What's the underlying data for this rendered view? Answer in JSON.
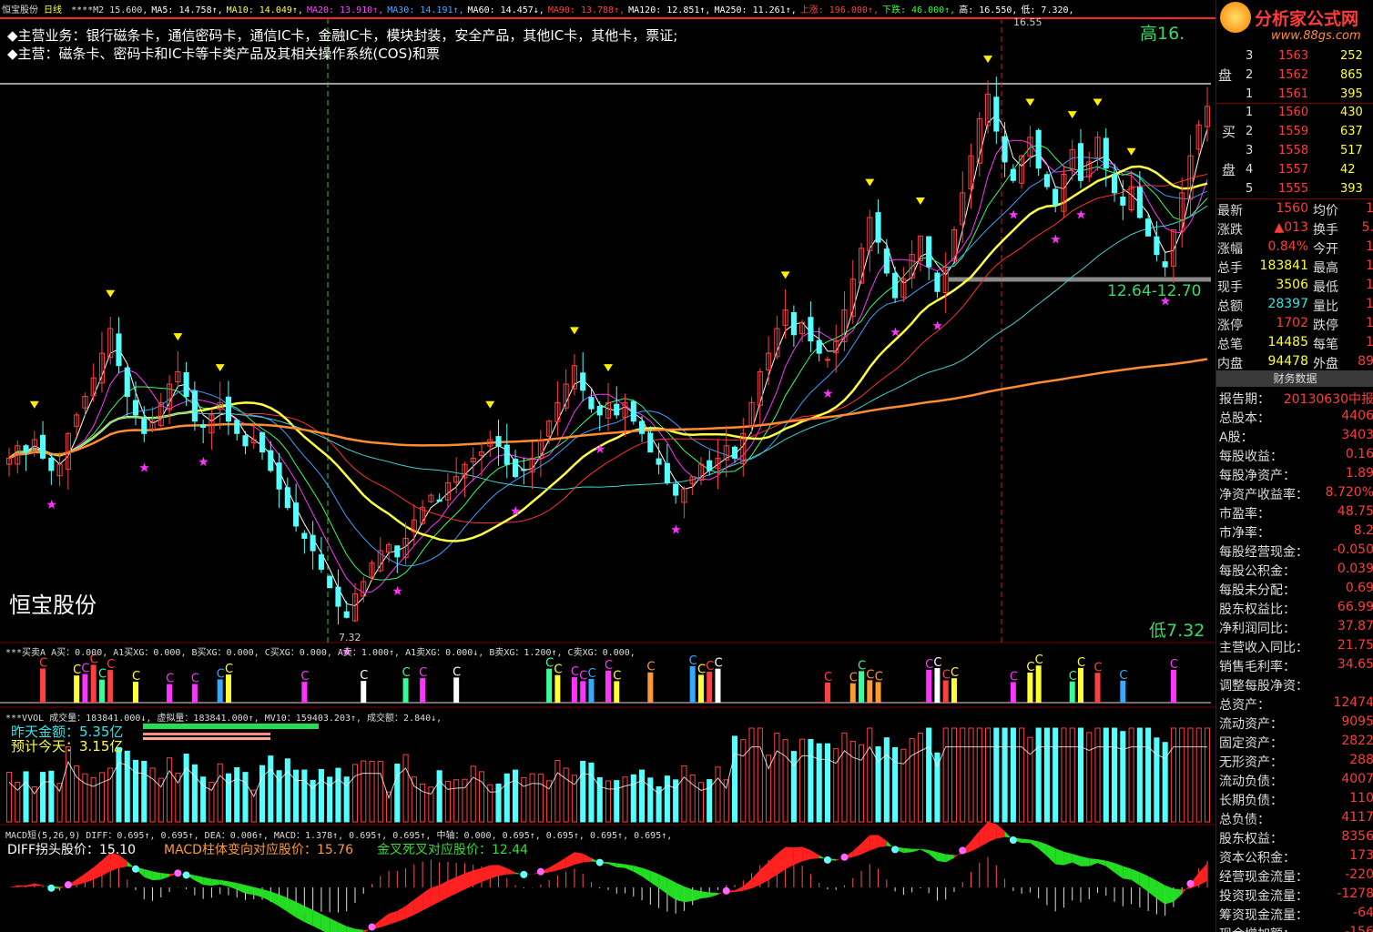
{
  "colors": {
    "up": "#ff4040",
    "down": "#54ffff",
    "ma5": "#ffffff",
    "ma10": "#ffff00",
    "ma20": "#ff33ff",
    "ma30": "#3aa0ff",
    "ma60": "#ffff44",
    "ma120": "#40d0d0",
    "ma250": "#ff8c30",
    "grid": "#7a0000"
  },
  "header": {
    "name": "恒宝股份",
    "period": "日线",
    "ma_items": [
      {
        "t": "****M2 15.600,",
        "c": "#dddddd"
      },
      {
        "t": "MA5: 14.758↑,",
        "c": "#ffffff"
      },
      {
        "t": "MA10: 14.049↑,",
        "c": "#ffff44"
      },
      {
        "t": "MA20: 13.910↑,",
        "c": "#ff44ff"
      },
      {
        "t": "MA30: 14.191↑,",
        "c": "#44aaff"
      },
      {
        "t": "MA60: 14.457↓,",
        "c": "#ffffff"
      },
      {
        "t": "MA90: 13.788↑,",
        "c": "#ff4040"
      },
      {
        "t": "MA120: 12.851↑,",
        "c": "#ffffff"
      },
      {
        "t": "MA250: 11.261↑,",
        "c": "#ffffff"
      },
      {
        "t": "上涨: 196.000↑,",
        "c": "#ff4040"
      },
      {
        "t": "下跌: 46.000↑,",
        "c": "#33ff33"
      },
      {
        "t": "高: 16.550,",
        "c": "#ffffff"
      },
      {
        "t": "低: 7.320,",
        "c": "#ffffff"
      }
    ],
    "business_line1": "◆主营业务：银行磁条卡，通信密码卡，通信IC卡，金融IC卡，模块封装，安全产品，其他IC卡，其他卡，票证;",
    "business_line2": "◆主营：磁条卡、密码卡和IC卡等卡类产品及其相关操作系统(COS)和票"
  },
  "chart_data": {
    "type": "candlestick",
    "stock_name": "恒宝股份",
    "high_label": "高16.",
    "high_mark": "16.55",
    "low_label": "低7.32",
    "low_mark": "7.32",
    "support_label": "12.64-12.70",
    "ylim": [
      7.0,
      17.0
    ],
    "close": [
      9.9,
      10.1,
      10.0,
      10.2,
      9.9,
      9.7,
      9.8,
      10.3,
      10.6,
      10.9,
      11.2,
      11.6,
      12.0,
      11.4,
      10.9,
      10.6,
      10.3,
      10.5,
      10.8,
      11.1,
      11.3,
      10.9,
      10.5,
      10.4,
      10.6,
      10.8,
      10.5,
      10.3,
      10.1,
      10.2,
      10.0,
      9.7,
      9.4,
      9.1,
      8.8,
      8.6,
      8.4,
      8.1,
      7.8,
      7.5,
      7.32,
      7.7,
      7.9,
      8.2,
      8.4,
      8.5,
      8.3,
      8.6,
      8.9,
      9.1,
      9.3,
      9.2,
      9.5,
      9.6,
      9.8,
      9.9,
      10.0,
      10.2,
      10.1,
      9.8,
      9.6,
      9.7,
      9.9,
      10.2,
      10.5,
      10.8,
      11.1,
      11.4,
      11.0,
      10.7,
      10.6,
      10.8,
      10.6,
      10.8,
      10.5,
      10.3,
      10.0,
      9.8,
      9.5,
      9.3,
      9.4,
      9.6,
      9.8,
      9.7,
      9.9,
      10.1,
      9.9,
      10.3,
      10.8,
      11.3,
      11.6,
      12.0,
      12.3,
      11.9,
      12.1,
      11.8,
      11.6,
      11.5,
      11.8,
      12.3,
      12.8,
      13.3,
      13.8,
      13.4,
      12.9,
      12.5,
      12.8,
      13.2,
      13.5,
      13.0,
      12.6,
      13.0,
      13.6,
      14.2,
      14.8,
      15.4,
      15.8,
      15.2,
      14.7,
      14.4,
      14.8,
      15.1,
      14.6,
      14.3,
      14.0,
      14.5,
      14.9,
      14.4,
      14.7,
      15.1,
      14.6,
      14.2,
      14.0,
      14.3,
      13.8,
      13.5,
      13.2,
      13.0,
      13.6,
      14.2,
      14.8,
      15.3,
      15.6
    ],
    "vol_labels": {
      "title": "***VVOL 成交量：183841.000↓, 虚拟量：183841.000↑, MV10：159403.203↑, 成交额：2.840↓,",
      "yesterday": "昨天金额：5.35亿",
      "today": "预计今天：3.15亿"
    },
    "buysell_title": "***买卖A A买：0.000, A1买XG：0.000, B买XG：0.000, C买XG：0.000, A卖：1.000↑, A1卖XG：0.000↓, B卖XG：1.200↑, C卖XG：0.000,",
    "macd_labels": {
      "title": "MACD短(5,26,9) DIFF：0.695↑, 0.695↑, DEA：0.006↑, MACD：1.378↑, 0.695↑, 0.695↑, 中轴：0.000, 0.695↑, 0.695↑, 0.695↑, 0.695↑,",
      "diff_price": "DIFF拐头股价：15.10",
      "macd_price": "MACD柱体变向对应股价：15.76",
      "cross_price": "金叉死叉对应股价：12.44"
    }
  },
  "orderbook": {
    "sell": [
      {
        "lvl": "3",
        "price": "1563",
        "vol": "252"
      },
      {
        "lvl": "2",
        "price": "1562",
        "vol": "865"
      },
      {
        "lvl": "1",
        "price": "1561",
        "vol": "395"
      }
    ],
    "buy": [
      {
        "lvl": "1",
        "price": "1560",
        "vol": "430"
      },
      {
        "lvl": "2",
        "price": "1559",
        "vol": "637"
      },
      {
        "lvl": "3",
        "price": "1558",
        "vol": "517"
      },
      {
        "lvl": "4",
        "price": "1557",
        "vol": "42"
      },
      {
        "lvl": "5",
        "price": "1555",
        "vol": "393"
      }
    ],
    "sell_label_1": "盘",
    "buy_label_1": "买",
    "buy_label_2": "盘"
  },
  "quote": [
    {
      "k": "最新",
      "v": "1560",
      "k2": "均价",
      "v2": "1"
    },
    {
      "k": "涨跌",
      "v": "▲013",
      "k2": "换手",
      "v2": "5."
    },
    {
      "k": "涨幅",
      "v": "0.84%",
      "k2": "今开",
      "v2": "1"
    },
    {
      "k": "总手",
      "v": "183841",
      "k2": "最高",
      "v2": "1"
    },
    {
      "k": "现手",
      "v": "3506",
      "k2": "最低",
      "v2": "1"
    },
    {
      "k": "总额",
      "v": "28397",
      "k2": "量比",
      "v2": "1"
    },
    {
      "k": "涨停",
      "v": "1702",
      "k2": "跌停",
      "v2": "1"
    },
    {
      "k": "总笔",
      "v": "14485",
      "k2": "每笔",
      "v2": "1"
    },
    {
      "k": "内盘",
      "v": "94478",
      "k2": "外盘",
      "v2": "89"
    }
  ],
  "fin_title": "财务数据",
  "fin": [
    {
      "k": "报告期：",
      "v": "20130630中报"
    },
    {
      "k": "总股本：",
      "v": "4406"
    },
    {
      "k": "A股：",
      "v": "3403"
    },
    {
      "k": "每股收益：",
      "v": "0.16"
    },
    {
      "k": "每股净资产：",
      "v": "1.89"
    },
    {
      "k": "净资产收益率：",
      "v": "8.720%"
    },
    {
      "k": "市盈率：",
      "v": "48.75"
    },
    {
      "k": "市净率：",
      "v": "8.2"
    },
    {
      "k": "每股经营现金：",
      "v": "-0.050"
    },
    {
      "k": "每股公积金：",
      "v": "0.039"
    },
    {
      "k": "每股未分配：",
      "v": "0.69"
    },
    {
      "k": "股东权益比：",
      "v": "66.99"
    },
    {
      "k": "净利润同比：",
      "v": "37.87"
    },
    {
      "k": "主营收入同比：",
      "v": "21.75"
    },
    {
      "k": "销售毛利率：",
      "v": "34.65"
    },
    {
      "k": "调整每股净资：",
      "v": ""
    },
    {
      "k": "总资产：",
      "v": "12474"
    },
    {
      "k": "流动资产：",
      "v": "9095"
    },
    {
      "k": "固定资产：",
      "v": "2822"
    },
    {
      "k": "无形资产：",
      "v": "288"
    },
    {
      "k": "流动负债：",
      "v": "4007"
    },
    {
      "k": "长期负债：",
      "v": "110"
    },
    {
      "k": "总负债：",
      "v": "4117"
    },
    {
      "k": "股东权益：",
      "v": "8356"
    },
    {
      "k": "资本公积金：",
      "v": "173"
    },
    {
      "k": "经营现金流量：",
      "v": "-220"
    },
    {
      "k": "投资现金流量：",
      "v": "-1278"
    },
    {
      "k": "筹资现金流量：",
      "v": "-64"
    },
    {
      "k": "现金增加额：",
      "v": "-156"
    }
  ],
  "logo": {
    "text": "分析家公式网",
    "url_text": "www.88gs.com"
  }
}
